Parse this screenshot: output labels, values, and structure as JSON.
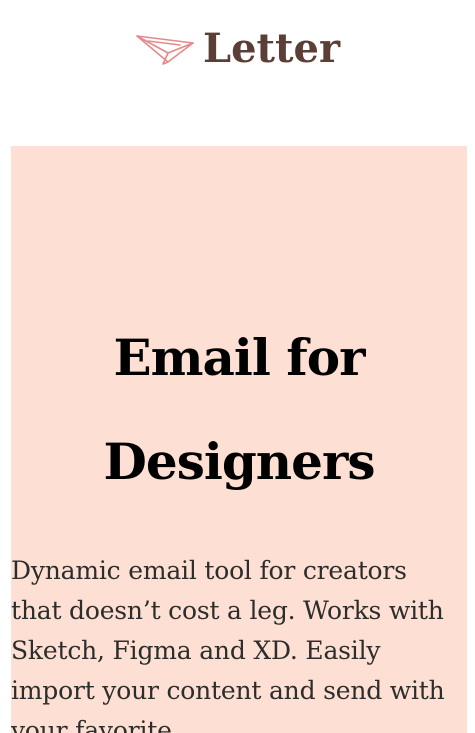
{
  "header": {
    "logo_icon": "paper-plane-icon",
    "logo_text": "Letter",
    "logo_color": "#5b3f37",
    "icon_color": "#e58a8a"
  },
  "hero": {
    "background_color": "#fde0d3",
    "title": "Email for Designers",
    "description": "Dynamic email tool for creators that doesn’t cost a leg. Works with Sketch, Figma and XD. Easily import your content and send with your favorite"
  }
}
